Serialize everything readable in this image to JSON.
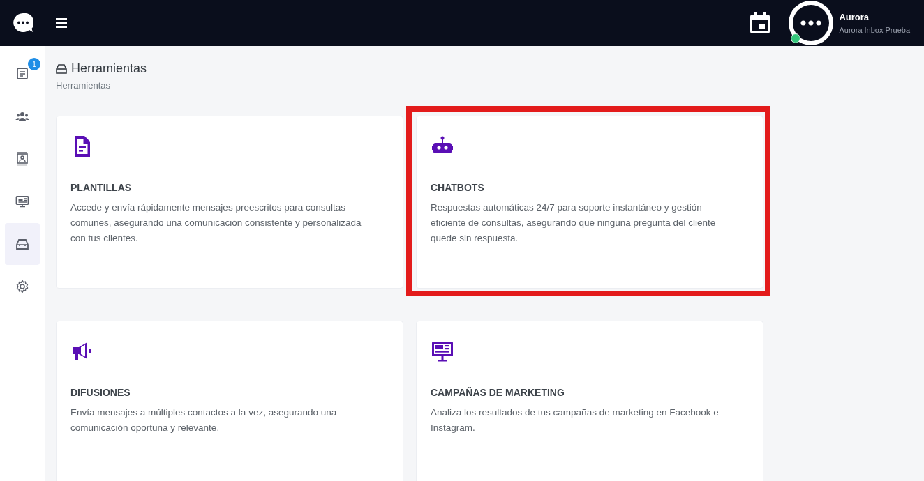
{
  "topbar": {
    "user": {
      "name": "Aurora",
      "account": "Aurora Inbox Prueba",
      "online": true
    }
  },
  "sidebar": {
    "items": [
      {
        "badge": "1",
        "selected": false
      },
      {
        "selected": false
      },
      {
        "selected": false
      },
      {
        "selected": false
      },
      {
        "selected": true
      },
      {
        "selected": false
      }
    ]
  },
  "page": {
    "title": "Herramientas",
    "breadcrumb": "Herramientas"
  },
  "cards": [
    {
      "title": "PLANTILLAS",
      "text": "Accede y envía rápidamente mensajes preescritos para consultas comunes, asegurando una comunicación consistente y personalizada con tus clientes.",
      "highlighted": false
    },
    {
      "title": "CHATBOTS",
      "text": "Respuestas automáticas 24/7 para soporte instantáneo y gestión eficiente de consultas, asegurando que ninguna pregunta del cliente quede sin respuesta.",
      "highlighted": true
    },
    {
      "title": "DIFUSIONES",
      "text": "Envía mensajes a múltiples contactos a la vez, asegurando una comunicación oportuna y relevante.",
      "highlighted": false
    },
    {
      "title": "CAMPAÑAS DE MARKETING",
      "text": "Analiza los resultados de tus campañas de marketing en Facebook e Instagram.",
      "highlighted": false
    }
  ]
}
